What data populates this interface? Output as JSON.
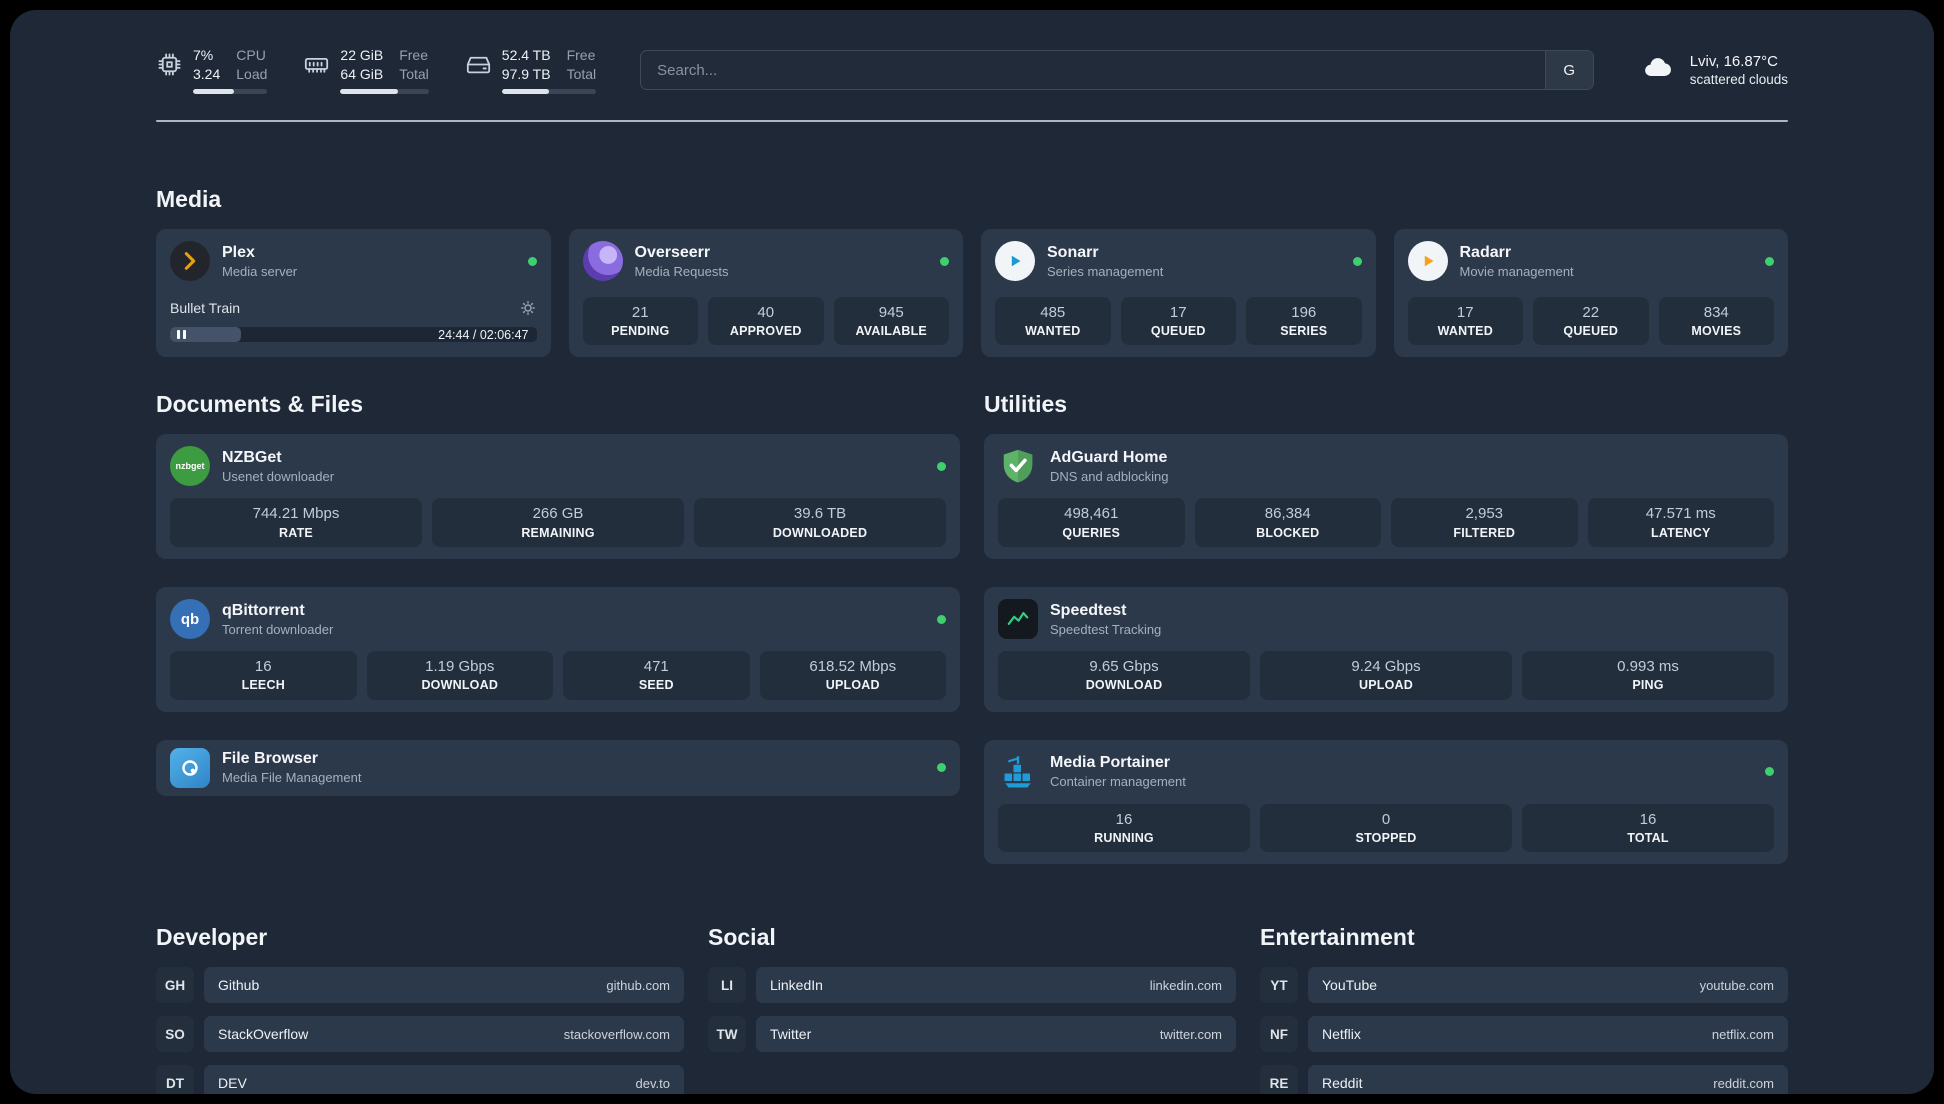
{
  "topbar": {
    "cpu": {
      "values": [
        "7%",
        "3.24"
      ],
      "labels": [
        "CPU",
        "Load"
      ],
      "bar_percent": 55
    },
    "ram": {
      "values": [
        "22 GiB",
        "64 GiB"
      ],
      "labels": [
        "Free",
        "Total"
      ],
      "bar_percent": 65
    },
    "disk": {
      "values": [
        "52.4 TB",
        "97.9 TB"
      ],
      "labels": [
        "Free",
        "Total"
      ],
      "bar_percent": 50
    },
    "search": {
      "placeholder": "Search...",
      "engine_label": "G"
    },
    "weather": {
      "location": "Lviv, 16.87°C",
      "condition": "scattered clouds"
    }
  },
  "sections": {
    "media": {
      "title": "Media",
      "plex": {
        "name": "Plex",
        "subtitle": "Media server",
        "now_playing": "Bullet Train",
        "time": "24:44 / 02:06:47",
        "progress_percent": 19.5
      },
      "overseerr": {
        "name": "Overseerr",
        "subtitle": "Media Requests",
        "stats": [
          {
            "value": "21",
            "label": "PENDING"
          },
          {
            "value": "40",
            "label": "APPROVED"
          },
          {
            "value": "945",
            "label": "AVAILABLE"
          }
        ]
      },
      "sonarr": {
        "name": "Sonarr",
        "subtitle": "Series management",
        "stats": [
          {
            "value": "485",
            "label": "WANTED"
          },
          {
            "value": "17",
            "label": "QUEUED"
          },
          {
            "value": "196",
            "label": "SERIES"
          }
        ]
      },
      "radarr": {
        "name": "Radarr",
        "subtitle": "Movie management",
        "stats": [
          {
            "value": "17",
            "label": "WANTED"
          },
          {
            "value": "22",
            "label": "QUEUED"
          },
          {
            "value": "834",
            "label": "MOVIES"
          }
        ]
      }
    },
    "documents": {
      "title": "Documents & Files",
      "nzbget": {
        "name": "NZBGet",
        "subtitle": "Usenet downloader",
        "icon_text": "nzbget",
        "stats": [
          {
            "value": "744.21 Mbps",
            "label": "RATE"
          },
          {
            "value": "266 GB",
            "label": "REMAINING"
          },
          {
            "value": "39.6 TB",
            "label": "DOWNLOADED"
          }
        ]
      },
      "qbittorrent": {
        "name": "qBittorrent",
        "subtitle": "Torrent downloader",
        "icon_text": "qb",
        "stats": [
          {
            "value": "16",
            "label": "LEECH"
          },
          {
            "value": "1.19 Gbps",
            "label": "DOWNLOAD"
          },
          {
            "value": "471",
            "label": "SEED"
          },
          {
            "value": "618.52 Mbps",
            "label": "UPLOAD"
          }
        ]
      },
      "filebrowser": {
        "name": "File Browser",
        "subtitle": "Media File Management"
      }
    },
    "utilities": {
      "title": "Utilities",
      "adguard": {
        "name": "AdGuard Home",
        "subtitle": "DNS and adblocking",
        "stats": [
          {
            "value": "498,461",
            "label": "QUERIES"
          },
          {
            "value": "86,384",
            "label": "BLOCKED"
          },
          {
            "value": "2,953",
            "label": "FILTERED"
          },
          {
            "value": "47.571 ms",
            "label": "LATENCY"
          }
        ]
      },
      "speedtest": {
        "name": "Speedtest",
        "subtitle": "Speedtest Tracking",
        "stats": [
          {
            "value": "9.65 Gbps",
            "label": "DOWNLOAD"
          },
          {
            "value": "9.24 Gbps",
            "label": "UPLOAD"
          },
          {
            "value": "0.993 ms",
            "label": "PING"
          }
        ]
      },
      "portainer": {
        "name": "Media Portainer",
        "subtitle": "Container management",
        "stats": [
          {
            "value": "16",
            "label": "RUNNING"
          },
          {
            "value": "0",
            "label": "STOPPED"
          },
          {
            "value": "16",
            "label": "TOTAL"
          }
        ]
      }
    },
    "bookmarks": {
      "developer": {
        "title": "Developer",
        "links": [
          {
            "abbr": "GH",
            "name": "Github",
            "url": "github.com"
          },
          {
            "abbr": "SO",
            "name": "StackOverflow",
            "url": "stackoverflow.com"
          },
          {
            "abbr": "DT",
            "name": "DEV",
            "url": "dev.to"
          }
        ]
      },
      "social": {
        "title": "Social",
        "links": [
          {
            "abbr": "LI",
            "name": "LinkedIn",
            "url": "linkedin.com"
          },
          {
            "abbr": "TW",
            "name": "Twitter",
            "url": "twitter.com"
          }
        ]
      },
      "entertainment": {
        "title": "Entertainment",
        "links": [
          {
            "abbr": "YT",
            "name": "YouTube",
            "url": "youtube.com"
          },
          {
            "abbr": "NF",
            "name": "Netflix",
            "url": "netflix.com"
          },
          {
            "abbr": "RE",
            "name": "Reddit",
            "url": "reddit.com"
          }
        ]
      }
    }
  },
  "colors": {
    "status_online": "#3ecf6f",
    "plex_accent": "#e5a00d",
    "background": "#1e2836"
  }
}
